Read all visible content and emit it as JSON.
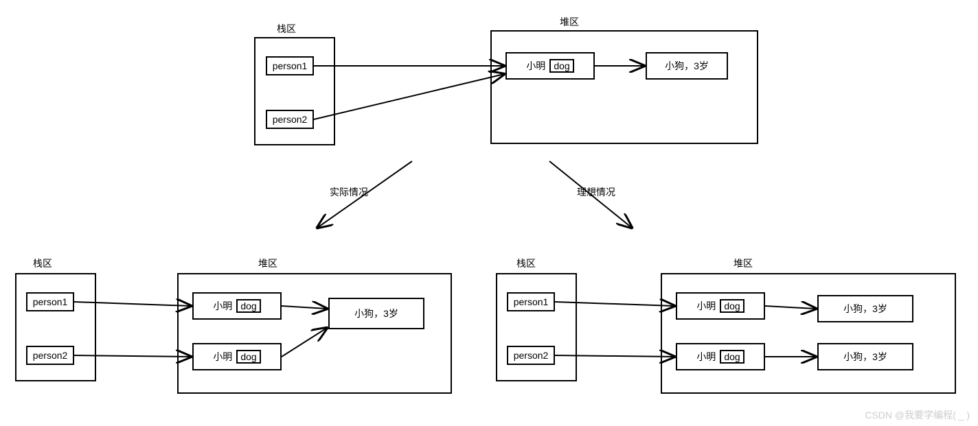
{
  "labels": {
    "stack": "栈区",
    "heap": "堆区",
    "person1": "person1",
    "person2": "person2",
    "xiaoming": "小明",
    "dog": "dog",
    "dogInfo": "小狗，3岁",
    "actual": "实际情况",
    "ideal": "理想情况",
    "watermark": "CSDN @我要学编程( _ )"
  }
}
